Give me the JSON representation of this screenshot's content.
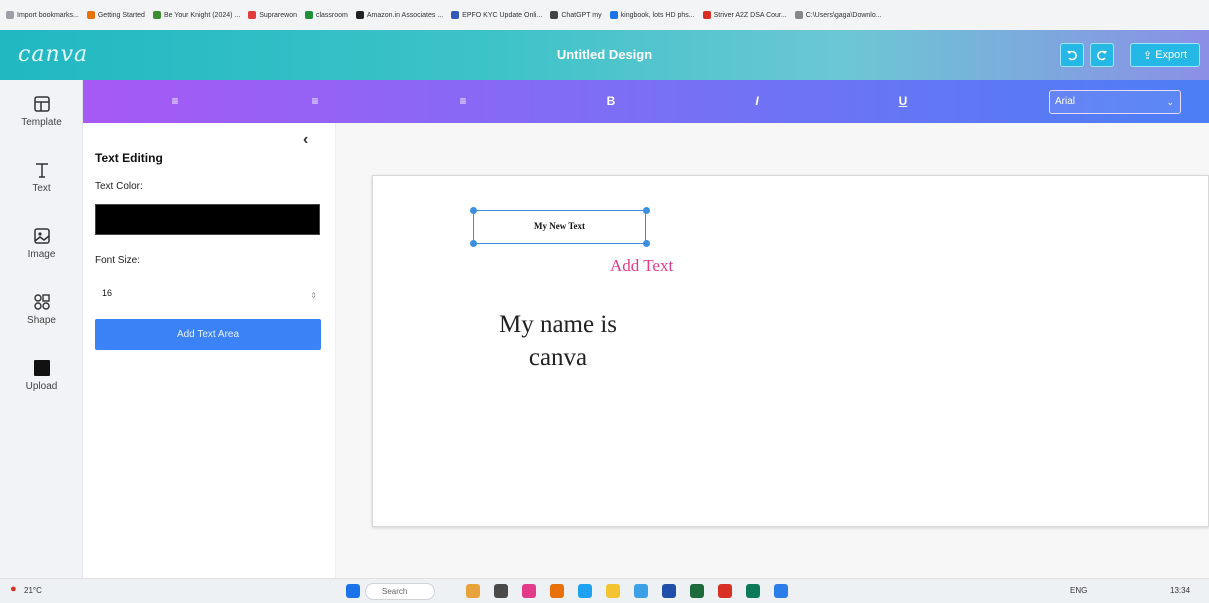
{
  "bookmarks": [
    {
      "label": "Import bookmarks...",
      "color": "#9aa0a6"
    },
    {
      "label": "Getting Started",
      "color": "#e8710a"
    },
    {
      "label": "Be Your Knight (2024) ...",
      "color": "#3c8d2f"
    },
    {
      "label": "Suprarewon",
      "color": "#e23b3b"
    },
    {
      "label": "classroom",
      "color": "#1f8f3a"
    },
    {
      "label": "Amazon.in Associates ...",
      "color": "#222222"
    },
    {
      "label": "EPFO KYC Update Onli...",
      "color": "#3557b7"
    },
    {
      "label": "ChatGPT my",
      "color": "#444444"
    },
    {
      "label": "kingbook, lots HD phs...",
      "color": "#1a73e8"
    },
    {
      "label": "Striver A2Z DSA Cour...",
      "color": "#d93025"
    },
    {
      "label": "C:\\Users\\gaga\\Downlo...",
      "color": "#888888"
    }
  ],
  "header": {
    "logo": "canva",
    "title": "Untitled Design",
    "export_label": "Export",
    "accent": "#21b8c2"
  },
  "toolbar": {
    "tools": [
      {
        "name": "align-left-icon",
        "glyph": "≡"
      },
      {
        "name": "align-center-icon",
        "glyph": "≡"
      },
      {
        "name": "align-right-icon",
        "glyph": "≡"
      },
      {
        "name": "bold-icon",
        "glyph": "B"
      },
      {
        "name": "italic-icon",
        "glyph": "I"
      },
      {
        "name": "underline-icon",
        "glyph": "U"
      }
    ],
    "font_value": "Arial"
  },
  "sidebar": {
    "items": [
      {
        "label": "Template",
        "icon": "template-icon"
      },
      {
        "label": "Text",
        "icon": "text-icon"
      },
      {
        "label": "Image",
        "icon": "image-icon"
      },
      {
        "label": "Shape",
        "icon": "shape-icon"
      },
      {
        "label": "Upload",
        "icon": "upload-icon"
      }
    ]
  },
  "panel": {
    "title": "Text Editing",
    "color_label": "Text Color:",
    "color_value": "#000000",
    "size_label": "Font Size:",
    "size_value": "16",
    "add_button": "Add Text Area",
    "collapse": "‹"
  },
  "canvas": {
    "textbox": "My New Text",
    "add_text": "Add Text",
    "line1": "My name is",
    "line2": "canva"
  },
  "taskbar": {
    "weather": "21°C",
    "search": "Search",
    "lang": "ENG",
    "time": "13:34"
  }
}
